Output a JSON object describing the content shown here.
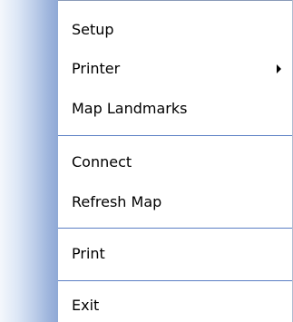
{
  "menu": {
    "items": [
      {
        "label": "Setup"
      },
      {
        "label": "Printer"
      },
      {
        "label": "Map Landmarks"
      },
      {
        "label": "Connect"
      },
      {
        "label": "Refresh Map"
      },
      {
        "label": "Print"
      },
      {
        "label": "Exit"
      }
    ]
  },
  "colors": {
    "separator": "#5b7fc4",
    "gutter_dark": "#8fa9d6",
    "gutter_light": "#f4f7fc"
  }
}
